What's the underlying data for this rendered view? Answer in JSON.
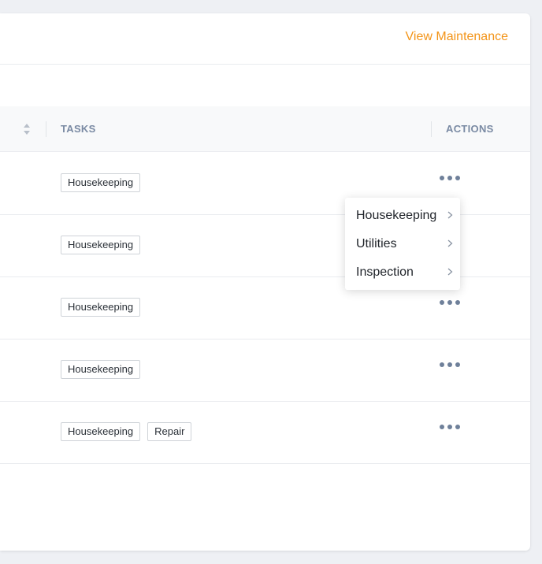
{
  "header": {
    "view_link": "View Maintenance"
  },
  "table": {
    "columns": {
      "tasks": "TASKS",
      "actions": "ACTIONS"
    },
    "rows": [
      {
        "tags": [
          "Housekeeping"
        ]
      },
      {
        "tags": [
          "Housekeeping"
        ]
      },
      {
        "tags": [
          "Housekeeping"
        ]
      },
      {
        "tags": [
          "Housekeeping"
        ]
      },
      {
        "tags": [
          "Housekeeping",
          "Repair"
        ]
      }
    ]
  },
  "menu": {
    "items": [
      {
        "label": "Housekeeping"
      },
      {
        "label": "Utilities"
      },
      {
        "label": "Inspection"
      }
    ]
  },
  "icons": {
    "sort": "sort-icon",
    "more": "more-horizontal-icon",
    "chevron": "chevron-right-icon"
  },
  "colors": {
    "accent": "#f39418",
    "header_text": "#7a8aa3",
    "dots": "#6f809a"
  }
}
